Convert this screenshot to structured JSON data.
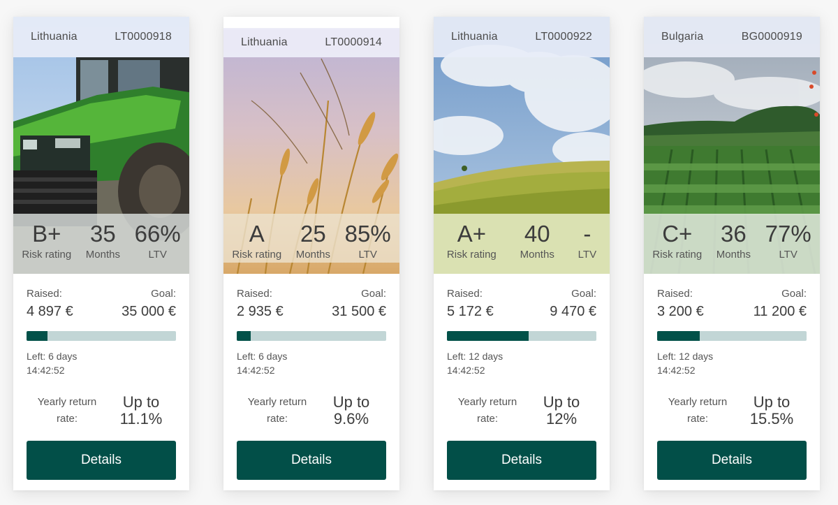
{
  "colors": {
    "accent": "#024f48",
    "progress_track": "#c2d6d6",
    "page_background": "#f7f7f7"
  },
  "cards": [
    {
      "country": "Lithuania",
      "code": "LT0000918",
      "image_icon": "tractor-photo",
      "risk_rating": "B+",
      "risk_label": "Risk rating",
      "months": "35",
      "months_label": "Months",
      "ltv": "66%",
      "ltv_label": "LTV",
      "raised_label": "Raised:",
      "raised": "4 897 €",
      "goal_label": "Goal:",
      "goal": "35 000 €",
      "progress": 0.14,
      "left": "Left: 6 days",
      "time": "14:42:52",
      "return_label": "Yearly return rate:",
      "return_value": "Up to 11.1%",
      "button": "Details"
    },
    {
      "country": "Lithuania",
      "code": "LT0000914",
      "image_icon": "wheat-photo",
      "risk_rating": "A",
      "risk_label": "Risk rating",
      "months": "25",
      "months_label": "Months",
      "ltv": "85%",
      "ltv_label": "LTV",
      "raised_label": "Raised:",
      "raised": "2 935 €",
      "goal_label": "Goal:",
      "goal": "31 500 €",
      "progress": 0.093,
      "left": "Left: 6 days",
      "time": "14:42:52",
      "return_label": "Yearly return rate:",
      "return_value": "Up to 9.6%",
      "button": "Details"
    },
    {
      "country": "Lithuania",
      "code": "LT0000922",
      "image_icon": "field-photo",
      "risk_rating": "A+",
      "risk_label": "Risk rating",
      "months": "40",
      "months_label": "Months",
      "ltv": "-",
      "ltv_label": "LTV",
      "raised_label": "Raised:",
      "raised": "5 172 €",
      "goal_label": "Goal:",
      "goal": "9 470 €",
      "progress": 0.546,
      "left": "Left: 12 days",
      "time": "14:42:52",
      "return_label": "Yearly return rate:",
      "return_value": "Up to 12%",
      "button": "Details"
    },
    {
      "country": "Bulgaria",
      "code": "BG0000919",
      "image_icon": "vineyard-photo",
      "risk_rating": "C+",
      "risk_label": "Risk rating",
      "months": "36",
      "months_label": "Months",
      "ltv": "77%",
      "ltv_label": "LTV",
      "raised_label": "Raised:",
      "raised": "3 200 €",
      "goal_label": "Goal:",
      "goal": "11 200 €",
      "progress": 0.286,
      "left": "Left: 12 days",
      "time": "14:42:52",
      "return_label": "Yearly return rate:",
      "return_value": "Up to 15.5%",
      "button": "Details"
    }
  ]
}
